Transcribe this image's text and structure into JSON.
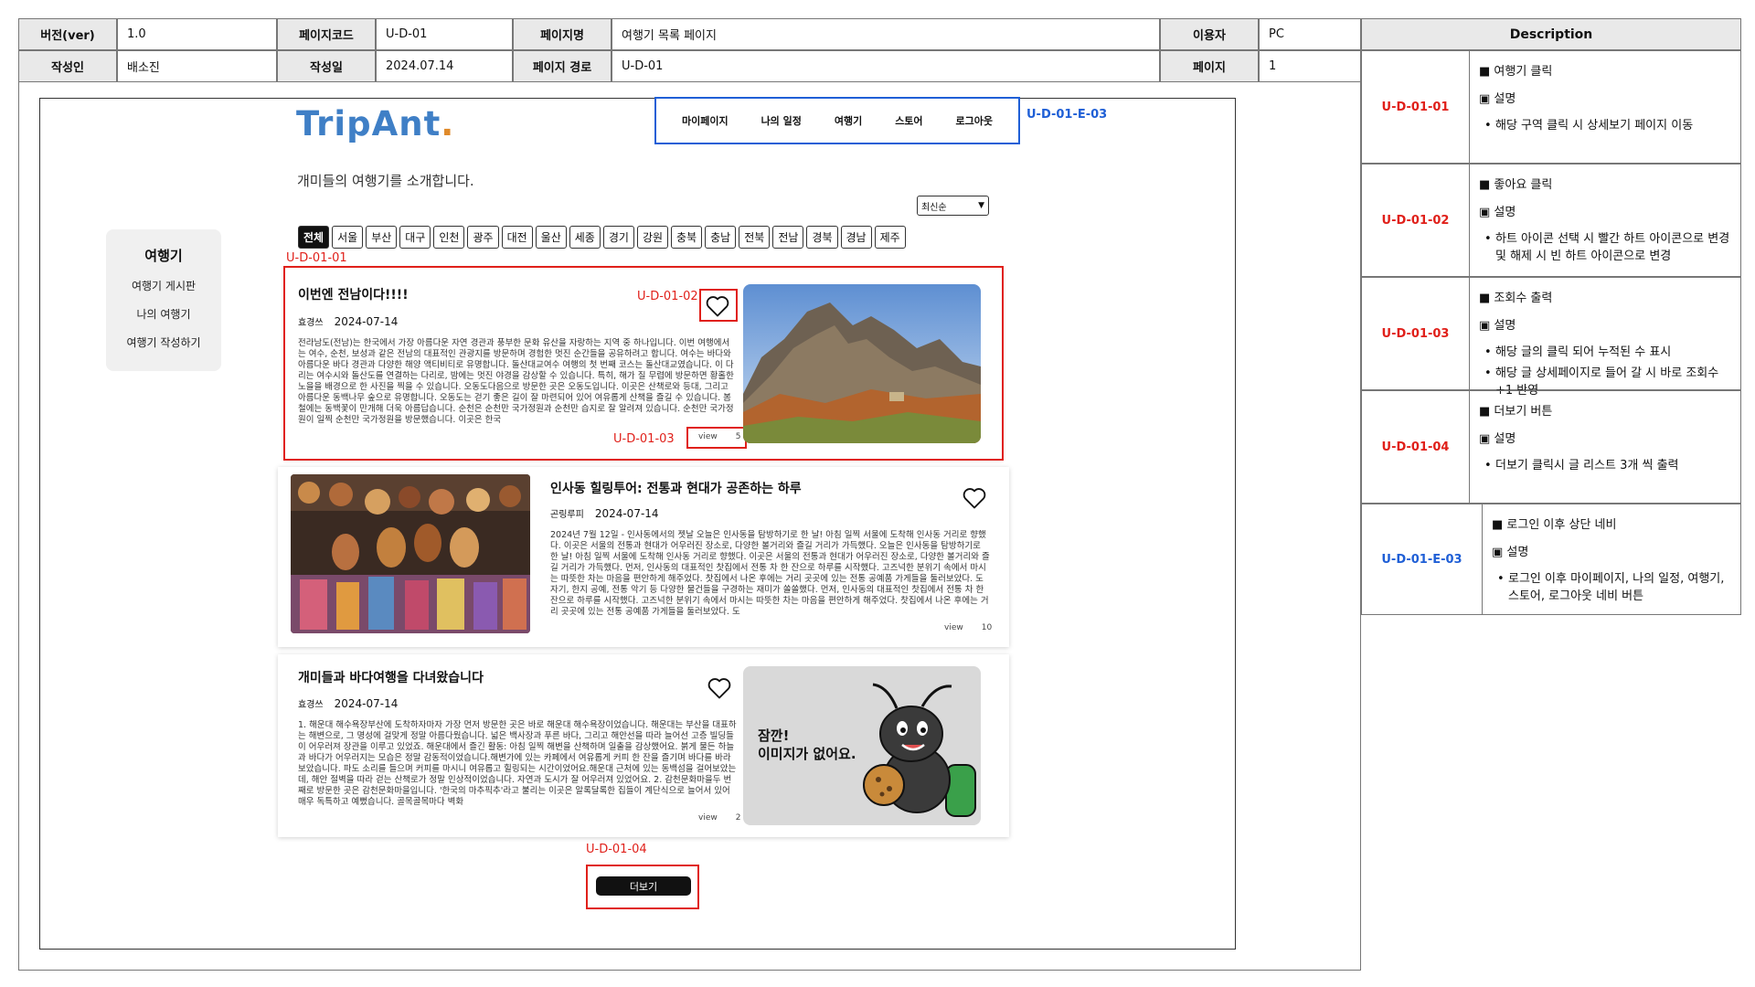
{
  "meta": {
    "version_label": "버전(ver)",
    "version": "1.0",
    "page_code_label": "페이지코드",
    "page_code": "U-D-01",
    "page_name_label": "페이지명",
    "page_name": "여행기 목록 페이지",
    "user_label": "이용자",
    "user": "PC",
    "author_label": "작성인",
    "author": "배소진",
    "date_label": "작성일",
    "date": "2024.07.14",
    "path_label": "페이지 경로",
    "path": "U-D-01",
    "page_label": "페이지",
    "page": "1"
  },
  "description": {
    "header": "Description",
    "rows": [
      {
        "id": "U-D-01-01",
        "title": "■ 여행기 클릭",
        "sub": "▣ 설명",
        "bullets": [
          "해당 구역 클릭 시 상세보기 페이지 이동"
        ]
      },
      {
        "id": "U-D-01-02",
        "title": "■ 좋아요 클릭",
        "sub": "▣ 설명",
        "bullets": [
          "하트 아이콘 선택 시 빨간 하트 아이콘으로 변경 및 해제 시 빈 하트 아이콘으로 변경"
        ]
      },
      {
        "id": "U-D-01-03",
        "title": "■ 조회수 출력",
        "sub": "▣ 설명",
        "bullets": [
          "해당 글의 클릭 되어 누적된 수 표시",
          "해당 글 상세페이지로 들어 갈 시 바로 조회수 +1 반영"
        ]
      },
      {
        "id": "U-D-01-04",
        "title": "■ 더보기 버튼",
        "sub": "▣ 설명",
        "bullets": [
          "더보기 클릭시 글 리스트 3개 씩 출력"
        ]
      },
      {
        "id": "U-D-01-E-03",
        "title": "■ 로그인 이후 상단 네비",
        "sub": "▣ 설명",
        "bullets": [
          "로그인 이후 마이페이지, 나의 일정, 여행기, 스토어, 로그아웃 네비 버튼"
        ]
      }
    ]
  },
  "page": {
    "logo_main": "TripAnt",
    "logo_dot": ".",
    "nav": [
      "마이페이지",
      "나의 일정",
      "여행기",
      "스토어",
      "로그아웃"
    ],
    "nav_tag": "U-D-01-E-03",
    "headline": "개미들의 여행기를 소개합니다.",
    "sort_selected": "최신순",
    "filters": [
      "전체",
      "서울",
      "부산",
      "대구",
      "인천",
      "광주",
      "대전",
      "울산",
      "세종",
      "경기",
      "강원",
      "충북",
      "충남",
      "전북",
      "전남",
      "경북",
      "경남",
      "제주"
    ],
    "sidebar": {
      "title": "여행기",
      "items": [
        "여행기 게시판",
        "나의 여행기",
        "여행기 작성하기"
      ]
    },
    "tags": {
      "card": "U-D-01-01",
      "like": "U-D-01-02",
      "view": "U-D-01-03",
      "more": "U-D-01-04"
    },
    "posts": [
      {
        "title": "이번엔 전남이다!!!!",
        "author": "효경쓰",
        "date": "2024-07-14",
        "body": "전라남도(전남)는 한국에서 가장 아름다운 자연 경관과 풍부한 문화 유산을 자랑하는 지역 중 하나입니다. 이번 여행에서는 여수, 순천, 보성과 같은 전남의 대표적인 관광지를 방문하며 경험한 멋진 순간들을 공유하려고 합니다. 여수는 바다와 아름다운 바다 경관과 다양한 해양 액티비티로 유명합니다. 돌산대교여수 여행의 첫 번째 코스는 돌산대교였습니다. 이 다리는 여수시와 돌산도를 연결하는 다리로, 밤에는 멋진 야경을 감상할 수 있습니다. 특히, 해가 질 무렵에 방문하면 황홀한 노을을 배경으로 한 사진을 찍을 수 있습니다. 오동도다음으로 방문한 곳은 오동도입니다. 이곳은 산책로와 등대, 그리고 아름다운 동백나무 숲으로 유명합니다. 오동도는 걷기 좋은 길이 잘 마련되어 있어 여유롭게 산책을 즐길 수 있습니다. 봄철에는 동백꽃이 만개해 더욱 아름답습니다. 순천은 순천만 국가정원과 순천만 습지로 잘 알려져 있습니다. 순천만 국가정원이 일찍 순천만 국가정원을 방문했습니다. 이곳은 한국",
        "view_label": "view",
        "views": "5",
        "image_alt": "rocky mountain autumn"
      },
      {
        "title": "인사동 힐링투어: 전통과 현대가 공존하는 하루",
        "author": "곤링루피",
        "date": "2024-07-14",
        "body": "2024년 7월 12일 - 인사동에서의 젯날 오늘은 인사동을 탐방하기로 한 날! 아침 일찍 서울에 도착해 인사동 거리로 향했다. 이곳은 서울의 전통과 현대가 어우러진 장소로, 다양한 볼거리와 즐길 거리가 가득했다. 오늘은 인사동을 탐방하기로 한 날! 아침 일찍 서울에 도착해 인사동 거리로 향했다. 이곳은 서울의 전통과 현대가 어우러진 장소로, 다양한 볼거리와 즐길 거리가 가득했다. 먼저, 인사동의 대표적인 찻집에서 전통 차 한 잔으로 하루를 시작했다. 고즈넉한 분위기 속에서 마시는 따뜻한 차는 마음을 편안하게 해주었다. 찻집에서 나온 후에는 거리 곳곳에 있는 전통 공예품 가게들을 둘러보았다. 도자기, 한지 공예, 전통 악기 등 다양한 물건들을 구경하는 재미가 쏠쏠했다. 먼저, 인사동의 대표적인 찻집에서 전통 차 한 잔으로 하루를 시작했다. 고즈넉한 분위기 속에서 마시는 따뜻한 차는 마음을 편안하게 해주었다. 찻집에서 나온 후에는 거리 곳곳에 있는 전통 공예품 가게들을 둘러보았다. 도",
        "view_label": "view",
        "views": "10",
        "image_alt": "masks shop"
      },
      {
        "title": "개미들과 바다여행을 다녀왔습니다",
        "author": "효경쓰",
        "date": "2024-07-14",
        "body": "1. 해운대 해수욕장부산에 도착하자마자 가장 먼저 방문한 곳은 바로 해운대 해수욕장이었습니다. 해운대는 부산을 대표하는 해변으로, 그 명성에 걸맞게 정말 아름다웠습니다. 넓은 백사장과 푸른 바다, 그리고 해안선을 따라 늘어선 고층 빌딩들이 어우러져 장관을 이루고 있었죠. 해운대에서 즐긴 활동: 아침 일찍 해변을 산책하며 일출을 감상했어요. 붉게 물든 하늘과 바다가 어우러지는 모습은 정말 감동적이었습니다.해변가에 있는 카페에서 여유롭게 커피 한 잔을 즐기며 바다를 바라보았습니다. 파도 소리를 들으며 커피를 마시니 여유롭고 힐링되는 시간이었어요.해운대 근처에 있는 동백섬을 걸어보았는데, 해안 절벽을 따라 걷는 산책로가 정말 인상적이었습니다. 자연과 도시가 잘 어우러져 있었어요. 2. 감천문화마을두 번째로 방문한 곳은 감천문화마을입니다. '한국의 마추픽추'라고 불리는 이곳은 알록달록한 집들이 계단식으로 늘어서 있어 매우 독특하고 예뻤습니다. 골목골목마다 벽화",
        "view_label": "view",
        "views": "2",
        "placeholder": [
          "잠깐!",
          "이미지가 없어요."
        ]
      }
    ],
    "more_label": "더보기"
  }
}
